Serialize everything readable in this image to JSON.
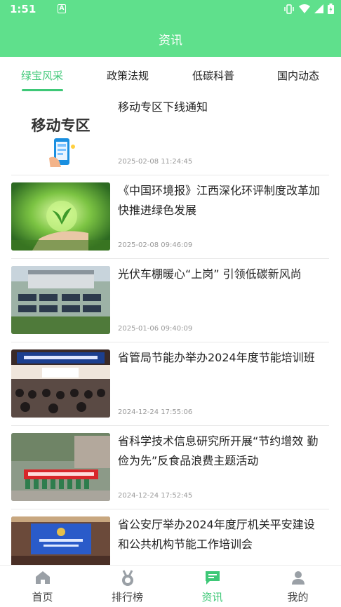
{
  "status_bar": {
    "time": "1:51",
    "notification_letter": "A"
  },
  "header": {
    "title": "资讯"
  },
  "tabs": [
    {
      "label": "绿宝风采",
      "active": true
    },
    {
      "label": "政策法规",
      "active": false
    },
    {
      "label": "低碳科普",
      "active": false
    },
    {
      "label": "国内动态",
      "active": false
    }
  ],
  "articles": [
    {
      "title": "移动专区下线通知",
      "time": "2025-02-08 11:24:45",
      "thumb_caption": "移动专区"
    },
    {
      "title": "《中国环境报》江西深化环评制度改革加快推进绿色发展",
      "time": "2025-02-08 09:46:09"
    },
    {
      "title": "光伏车棚暖心“上岗” 引领低碳新风尚",
      "time": "2025-01-06 09:40:09"
    },
    {
      "title": "省管局节能办举办2024年度节能培训班",
      "time": "2024-12-24 17:55:06"
    },
    {
      "title": "省科学技术信息研究所开展“节约增效 勤俭为先”反食品浪费主题活动",
      "time": "2024-12-24 17:52:45"
    },
    {
      "title": "省公安厅举办2024年度厅机关平安建设和公共机构节能工作培训会",
      "time": ""
    }
  ],
  "bottom_nav": [
    {
      "label": "首页",
      "icon": "home-icon",
      "active": false
    },
    {
      "label": "排行榜",
      "icon": "medal-icon",
      "active": false
    },
    {
      "label": "资讯",
      "icon": "message-icon",
      "active": true
    },
    {
      "label": "我的",
      "icon": "person-icon",
      "active": false
    }
  ],
  "colors": {
    "primary": "#5fe08c",
    "accent": "#3ec877",
    "inactive": "#9aa0a6"
  }
}
